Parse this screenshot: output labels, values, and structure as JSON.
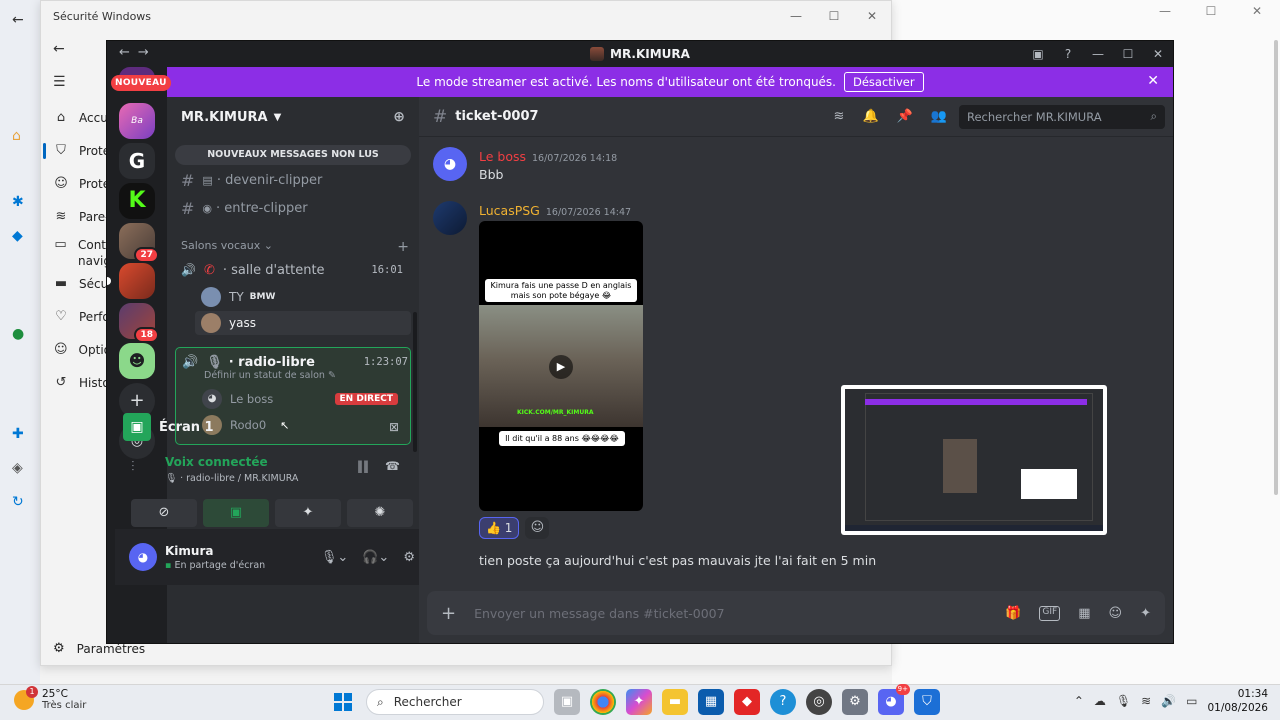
{
  "winsec": {
    "title": "Sécurité Windows",
    "nav": [
      {
        "label": "Accu",
        "icon": "home-icon"
      },
      {
        "label": "Prote",
        "icon": "shield-icon"
      },
      {
        "label": "Prote",
        "icon": "person-icon"
      },
      {
        "label": "Pare-",
        "icon": "wifi-icon"
      },
      {
        "label": "Contr",
        "label2": "navig",
        "icon": "browser-icon"
      },
      {
        "label": "Sécu",
        "icon": "laptop-icon"
      },
      {
        "label": "Perfo",
        "icon": "heart-icon"
      },
      {
        "label": "Optio",
        "icon": "family-icon"
      },
      {
        "label": "Histo",
        "icon": "history-icon"
      }
    ],
    "settings": "Paramètres"
  },
  "discord": {
    "title": "MR.KIMURA",
    "banner": {
      "text": "Le mode streamer est activé. Les noms d'utilisateur ont été tronqués.",
      "button": "Désactiver"
    },
    "guilds": {
      "nouveau": "NOUVEAU",
      "badges": [
        "27",
        "18"
      ]
    },
    "server": {
      "name": "MR.KIMURA",
      "new_messages": "NOUVEAUX MESSAGES NON LUS",
      "channels": [
        "devenir-clipper",
        "entre-clipper"
      ],
      "voice_category": "Salons vocaux",
      "voice1": {
        "name": "salle d'attente",
        "time": "16:01",
        "users": [
          {
            "name": "TY",
            "tag": "BMW"
          },
          {
            "name": "yass"
          }
        ]
      },
      "voice2": {
        "name": "radio-libre",
        "time": "1:23:07",
        "status": "Définir un statut de salon",
        "users": [
          {
            "name": "Le boss",
            "live": "EN DIRECT"
          },
          {
            "name": "Rodo0"
          }
        ]
      }
    },
    "panel": {
      "screen": "Écran 1",
      "voice_status": "Voix connectée",
      "voice_sub": "radio-libre / MR.KIMURA",
      "user": "Kimura",
      "user_status": "En partage d'écran"
    },
    "chat": {
      "channel": "ticket-0007",
      "search_placeholder": "Rechercher MR.KIMURA",
      "messages": [
        {
          "author": "Le boss",
          "time": "16/07/2026 14:18",
          "text": "Bbb",
          "color": "#f23f43"
        },
        {
          "author": "LucasPSG",
          "time": "16/07/2026 14:47",
          "color": "#f0b232",
          "video": {
            "caption1": "Kimura fais une passe D en anglais mais son pote bégaye 😂",
            "watermark": "KICK.COM/MR_KIMURA",
            "caption2": "Il dit qu'il a 88 ans 😂😂😂😂"
          },
          "reaction": {
            "emoji": "👍",
            "count": "1"
          },
          "text": "tien poste ça aujourd'hui c'est pas mauvais jte l'ai fait en 5 min"
        }
      ],
      "composer_placeholder": "Envoyer un message dans #ticket-0007"
    }
  },
  "taskbar": {
    "temp": "25°C",
    "weather": "Très clair",
    "weather_badge": "1",
    "search": "Rechercher",
    "discord_badge": "9+",
    "time": "01:34",
    "date": "01/08/2026"
  }
}
